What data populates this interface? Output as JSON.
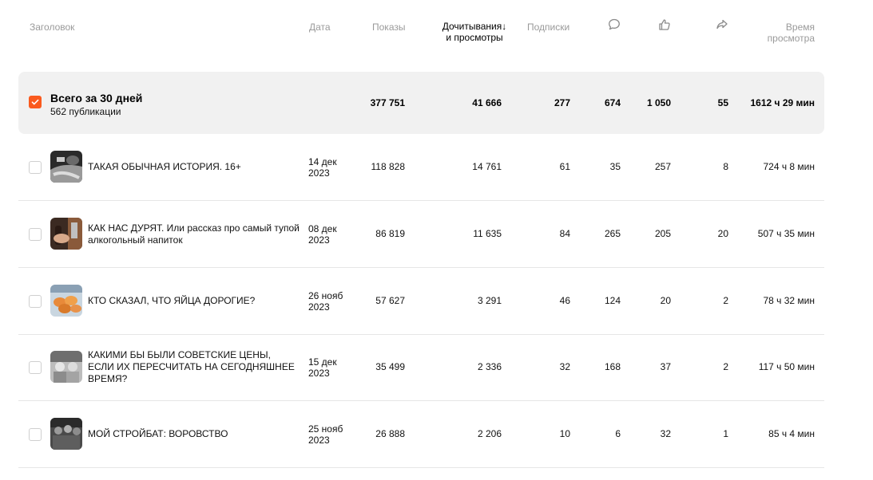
{
  "header": {
    "title": "Заголовок",
    "date": "Дата",
    "shows": "Показы",
    "reads_line1": "Дочитывания",
    "reads_line2": "и просмотры",
    "reads_sort_arrow": "↓",
    "subscriptions": "Подписки",
    "comments_icon": "comment-icon",
    "likes_icon": "thumbs-up-icon",
    "shares_icon": "share-icon",
    "time_line1": "Время",
    "time_line2": "просмотра"
  },
  "summary": {
    "title": "Всего за 30 дней",
    "subtitle": "562 публикации",
    "checked": true,
    "shows": "377 751",
    "reads": "41 666",
    "subscriptions": "277",
    "comments": "674",
    "likes": "1 050",
    "shares": "55",
    "time": "1612 ч 29 мин"
  },
  "rows": [
    {
      "title": "ТАКАЯ ОБЫЧНАЯ ИСТОРИЯ. 16+",
      "date_line1": "14 дек",
      "date_line2": "2023",
      "shows": "118 828",
      "reads": "14 761",
      "subscriptions": "61",
      "comments": "35",
      "likes": "257",
      "shares": "8",
      "time": "724 ч 8 мин"
    },
    {
      "title": "КАК НАС ДУРЯТ. Или рассказ про самый тупой алкогольный напиток",
      "date_line1": "08 дек",
      "date_line2": "2023",
      "shows": "86 819",
      "reads": "11 635",
      "subscriptions": "84",
      "comments": "265",
      "likes": "205",
      "shares": "20",
      "time": "507 ч 35 мин"
    },
    {
      "title": "КТО СКАЗАЛ, ЧТО ЯЙЦА ДОРОГИЕ?",
      "date_line1": "26 нояб",
      "date_line2": "2023",
      "shows": "57 627",
      "reads": "3 291",
      "subscriptions": "46",
      "comments": "124",
      "likes": "20",
      "shares": "2",
      "time": "78 ч 32 мин"
    },
    {
      "title": "КАКИМИ БЫ БЫЛИ СОВЕТСКИЕ ЦЕНЫ, ЕСЛИ ИХ ПЕРЕСЧИТАТЬ НА СЕГОДНЯШНЕЕ ВРЕМЯ?",
      "date_line1": "15 дек",
      "date_line2": "2023",
      "shows": "35 499",
      "reads": "2 336",
      "subscriptions": "32",
      "comments": "168",
      "likes": "37",
      "shares": "2",
      "time": "117 ч 50 мин"
    },
    {
      "title": "МОЙ СТРОЙБАТ: ВОРОВСТВО",
      "date_line1": "25 нояб",
      "date_line2": "2023",
      "shows": "26 888",
      "reads": "2 206",
      "subscriptions": "10",
      "comments": "6",
      "likes": "32",
      "shares": "1",
      "time": "85 ч 4 мин"
    }
  ],
  "colors": {
    "accent": "#fa5a1e",
    "summary_bg": "#f1f1f1",
    "header_text": "#9a9a9a",
    "divider": "#e6e6e6"
  }
}
